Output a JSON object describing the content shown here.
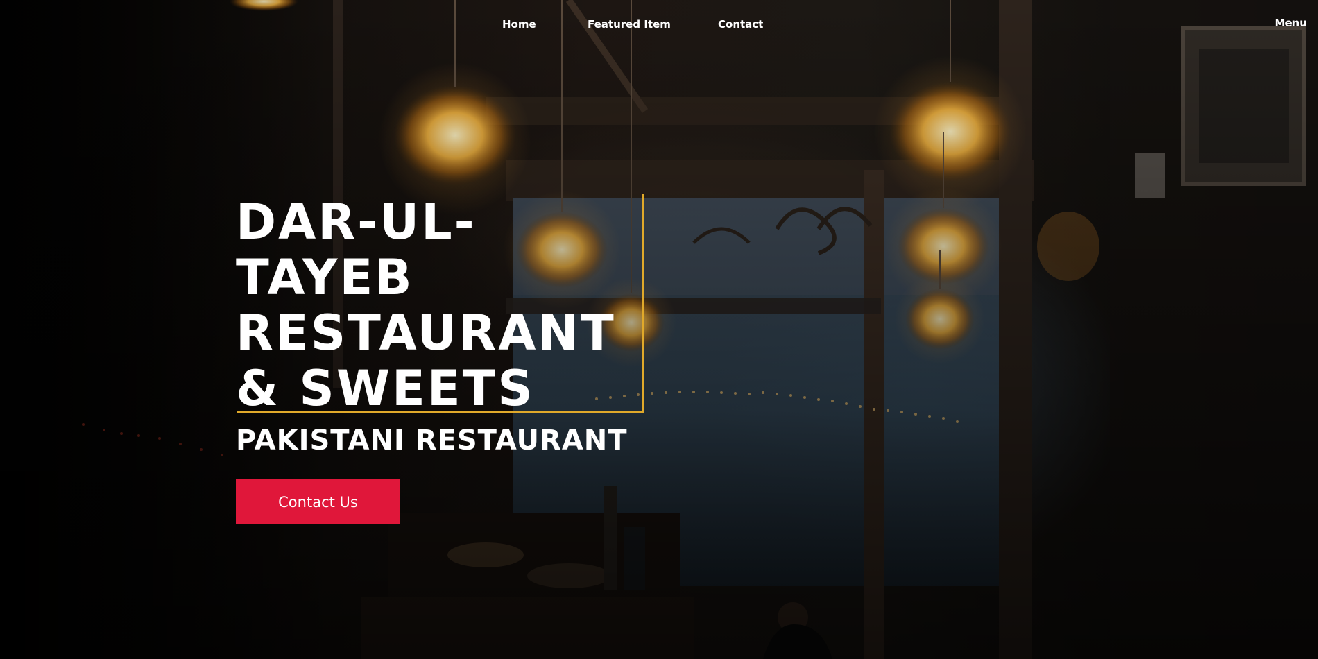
{
  "nav": {
    "items": [
      {
        "label": "Home"
      },
      {
        "label": "Featured Item"
      },
      {
        "label": "Contact"
      }
    ],
    "menu_label": "Menu"
  },
  "hero": {
    "title_lines": [
      "DAR-UL-",
      "TAYEB",
      "RESTAURANT",
      "& SWEETS"
    ],
    "subtitle": "PAKISTANI RESTAURANT",
    "cta_label": "Contact Us"
  },
  "colors": {
    "accent_red": "#e0173a",
    "accent_gold": "#e0a92a",
    "text": "#ffffff"
  },
  "background": {
    "scene": "dimly lit restaurant interior with hanging lamps",
    "icon": "background-photo"
  }
}
